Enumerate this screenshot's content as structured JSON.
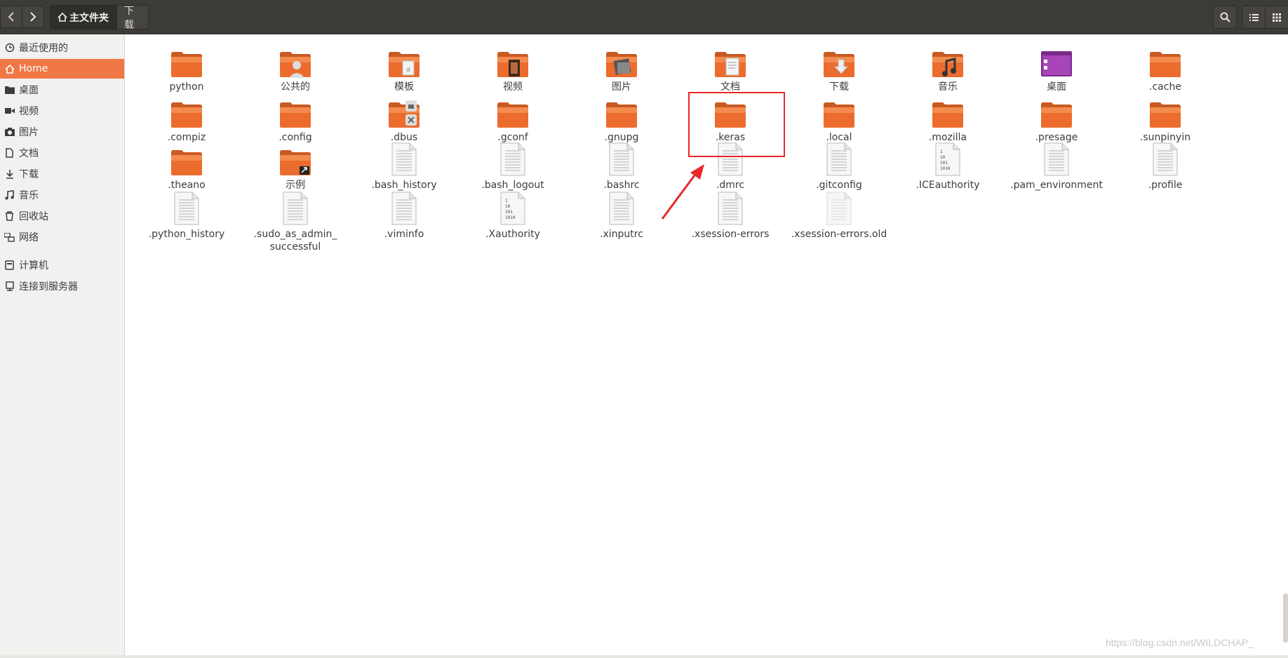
{
  "toolbar": {
    "breadcrumb_home": "主文件夹",
    "breadcrumb_current": "下载"
  },
  "sidebar": {
    "items": [
      {
        "label": "最近使用的",
        "icon": "clock-icon"
      },
      {
        "label": "Home",
        "icon": "home-icon",
        "active": true
      },
      {
        "label": "桌面",
        "icon": "desktop-folder-icon"
      },
      {
        "label": "视频",
        "icon": "video-icon"
      },
      {
        "label": "图片",
        "icon": "camera-icon"
      },
      {
        "label": "文档",
        "icon": "document-icon"
      },
      {
        "label": "下载",
        "icon": "download-icon"
      },
      {
        "label": "音乐",
        "icon": "music-icon"
      },
      {
        "label": "回收站",
        "icon": "trash-icon"
      },
      {
        "label": "网络",
        "icon": "network-icon"
      },
      {
        "label": "计算机",
        "icon": "computer-icon"
      },
      {
        "label": "连接到服务器",
        "icon": "server-icon"
      }
    ]
  },
  "files": [
    {
      "name": "python",
      "type": "folder"
    },
    {
      "name": "公共的",
      "type": "folder-public"
    },
    {
      "name": "模板",
      "type": "folder-templates"
    },
    {
      "name": "视频",
      "type": "folder-video"
    },
    {
      "name": "图片",
      "type": "folder-pictures"
    },
    {
      "name": "文档",
      "type": "folder-documents"
    },
    {
      "name": "下载",
      "type": "folder-download"
    },
    {
      "name": "音乐",
      "type": "folder-music"
    },
    {
      "name": "桌面",
      "type": "folder-desktop"
    },
    {
      "name": ".cache",
      "type": "folder"
    },
    {
      "name": ".compiz",
      "type": "folder"
    },
    {
      "name": ".config",
      "type": "folder"
    },
    {
      "name": ".dbus",
      "type": "folder-locked"
    },
    {
      "name": ".gconf",
      "type": "folder"
    },
    {
      "name": ".gnupg",
      "type": "folder"
    },
    {
      "name": ".keras",
      "type": "folder"
    },
    {
      "name": ".local",
      "type": "folder"
    },
    {
      "name": ".mozilla",
      "type": "folder"
    },
    {
      "name": ".presage",
      "type": "folder"
    },
    {
      "name": ".sunpinyin",
      "type": "folder"
    },
    {
      "name": ".theano",
      "type": "folder"
    },
    {
      "name": "示例",
      "type": "folder-link"
    },
    {
      "name": ".bash_history",
      "type": "text"
    },
    {
      "name": ".bash_logout",
      "type": "text"
    },
    {
      "name": ".bashrc",
      "type": "text"
    },
    {
      "name": ".dmrc",
      "type": "text"
    },
    {
      "name": ".gitconfig",
      "type": "text"
    },
    {
      "name": ".ICEauthority",
      "type": "binary"
    },
    {
      "name": ".pam_environment",
      "type": "text"
    },
    {
      "name": ".profile",
      "type": "text"
    },
    {
      "name": ".python_history",
      "type": "text"
    },
    {
      "name": ".sudo_as_admin_\nsuccessful",
      "type": "text"
    },
    {
      "name": ".viminfo",
      "type": "text"
    },
    {
      "name": ".Xauthority",
      "type": "binary"
    },
    {
      "name": ".xinputrc",
      "type": "text"
    },
    {
      "name": ".xsession-errors",
      "type": "text"
    },
    {
      "name": ".xsession-errors.old",
      "type": "text-faded"
    }
  ],
  "watermark": "https://blog.csdn.net/WILDCHAP_",
  "colors": {
    "accent": "#f07746",
    "highlight": "#e8282a",
    "folder": "#ec6c2e"
  }
}
